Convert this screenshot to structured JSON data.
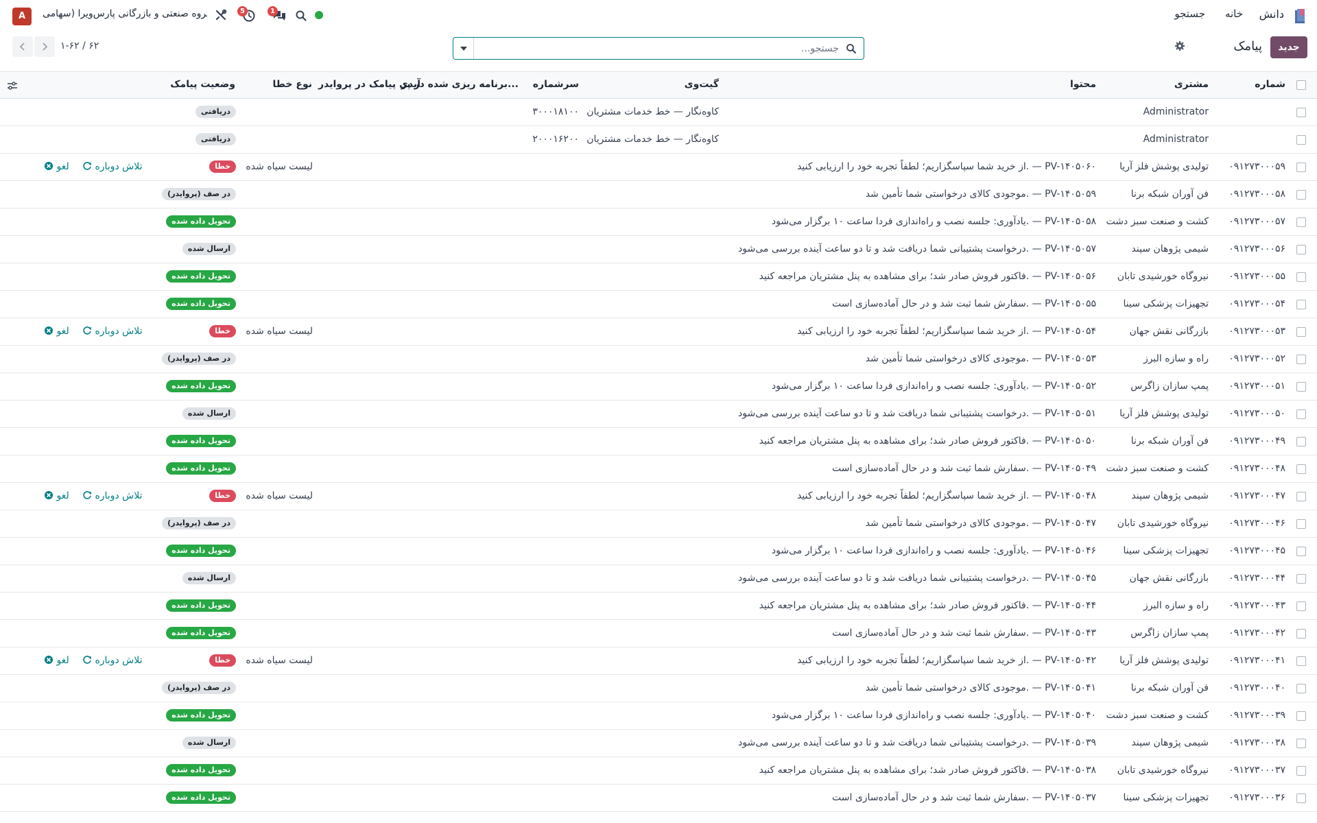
{
  "navbar": {
    "app_name": "دانش",
    "menu_home": "خانه",
    "menu_search": "جستجو",
    "company": "گروه صنعتی و بازرگانی پارس‌ویرا (سهامی ...",
    "activity_count": "5",
    "chat_count": "1",
    "avatar_letter": "A"
  },
  "control": {
    "new_button": "جدید",
    "title": "پیامک",
    "search_placeholder": "جستجو...",
    "pager": "۱-۶۲ / ۶۲"
  },
  "columns": {
    "number": "شماره",
    "customer": "مشتری",
    "content": "محتوا",
    "gateway": "گیت‌وی",
    "sender": "سرشماره",
    "scheduled": "برنامه ریزی شده در پر...",
    "provider_id": "آیدی پیامک در پروایدر",
    "error_type": "نوع خطا",
    "status": "وضعیت پیامک"
  },
  "actions": {
    "retry": "تلاش دوباره",
    "cancel": "لغو"
  },
  "rows": [
    {
      "number": "",
      "customer": "Administrator",
      "content": "",
      "gateway": "کاوه‌نگار — خط خدمات مشتریان",
      "sender": "۳۰۰۰۱۸۱۰۰",
      "error_type": "",
      "status": "دریافتی",
      "status_kind": "muted"
    },
    {
      "number": "",
      "customer": "Administrator",
      "content": "",
      "gateway": "کاوه‌نگار — خط خدمات مشتریان",
      "sender": "۲۰۰۰۱۶۲۰۰",
      "error_type": "",
      "status": "دریافتی",
      "status_kind": "muted"
    },
    {
      "number": "۰۹۱۲۷۳۰۰۰۵۹",
      "customer": "تولیدی پوشش فلز آریا",
      "content": "از خرید شما سپاسگزاریم؛ لطفاً تجربه خود را ارزیابی کنید. — PV-۱۴۰۵۰۶۰",
      "gateway": "",
      "sender": "",
      "error_type": "لیست سیاه شده",
      "status": "خطا",
      "status_kind": "danger"
    },
    {
      "number": "۰۹۱۲۷۳۰۰۰۵۸",
      "customer": "فن آوران شبکه برنا",
      "content": "موجودی کالای درخواستی شما تأمین شد. — PV-۱۴۰۵۰۵۹",
      "gateway": "",
      "sender": "",
      "error_type": "",
      "status": "در صف (پروایدر)",
      "status_kind": "muted"
    },
    {
      "number": "۰۹۱۲۷۳۰۰۰۵۷",
      "customer": "کشت و صنعت سبز دشت",
      "content": "یادآوری: جلسه نصب و راه‌اندازی فردا ساعت ۱۰ برگزار می‌شود. — PV-۱۴۰۵۰۵۸",
      "gateway": "",
      "sender": "",
      "error_type": "",
      "status": "تحویل داده شده",
      "status_kind": "success"
    },
    {
      "number": "۰۹۱۲۷۳۰۰۰۵۶",
      "customer": "شیمی پژوهان سپند",
      "content": "درخواست پشتیبانی شما دریافت شد و تا دو ساعت آینده بررسی می‌شود. — PV-۱۴۰۵۰۵۷",
      "gateway": "",
      "sender": "",
      "error_type": "",
      "status": "ارسال شده",
      "status_kind": "muted"
    },
    {
      "number": "۰۹۱۲۷۳۰۰۰۵۵",
      "customer": "نیروگاه خورشیدی تابان",
      "content": "فاکتور فروش صادر شد؛ برای مشاهده به پنل مشتریان مراجعه کنید. — PV-۱۴۰۵۰۵۶",
      "gateway": "",
      "sender": "",
      "error_type": "",
      "status": "تحویل داده شده",
      "status_kind": "success"
    },
    {
      "number": "۰۹۱۲۷۳۰۰۰۵۴",
      "customer": "تجهیزات پزشکی سینا",
      "content": "سفارش شما ثبت شد و در حال آماده‌سازی است. — PV-۱۴۰۵۰۵۵",
      "gateway": "",
      "sender": "",
      "error_type": "",
      "status": "تحویل داده شده",
      "status_kind": "success"
    },
    {
      "number": "۰۹۱۲۷۳۰۰۰۵۳",
      "customer": "بازرگانی نقش جهان",
      "content": "از خرید شما سپاسگزاریم؛ لطفاً تجربه خود را ارزیابی کنید. — PV-۱۴۰۵۰۵۴",
      "gateway": "",
      "sender": "",
      "error_type": "لیست سیاه شده",
      "status": "خطا",
      "status_kind": "danger"
    },
    {
      "number": "۰۹۱۲۷۳۰۰۰۵۲",
      "customer": "راه و سازه البرز",
      "content": "موجودی کالای درخواستی شما تأمین شد. — PV-۱۴۰۵۰۵۳",
      "gateway": "",
      "sender": "",
      "error_type": "",
      "status": "در صف (پروایدر)",
      "status_kind": "muted"
    },
    {
      "number": "۰۹۱۲۷۳۰۰۰۵۱",
      "customer": "پمپ سازان زاگرس",
      "content": "یادآوری: جلسه نصب و راه‌اندازی فردا ساعت ۱۰ برگزار می‌شود. — PV-۱۴۰۵۰۵۲",
      "gateway": "",
      "sender": "",
      "error_type": "",
      "status": "تحویل داده شده",
      "status_kind": "success"
    },
    {
      "number": "۰۹۱۲۷۳۰۰۰۵۰",
      "customer": "تولیدی پوشش فلز آریا",
      "content": "درخواست پشتیبانی شما دریافت شد و تا دو ساعت آینده بررسی می‌شود. — PV-۱۴۰۵۰۵۱",
      "gateway": "",
      "sender": "",
      "error_type": "",
      "status": "ارسال شده",
      "status_kind": "muted"
    },
    {
      "number": "۰۹۱۲۷۳۰۰۰۴۹",
      "customer": "فن آوران شبکه برنا",
      "content": "فاکتور فروش صادر شد؛ برای مشاهده به پنل مشتریان مراجعه کنید. — PV-۱۴۰۵۰۵۰",
      "gateway": "",
      "sender": "",
      "error_type": "",
      "status": "تحویل داده شده",
      "status_kind": "success"
    },
    {
      "number": "۰۹۱۲۷۳۰۰۰۴۸",
      "customer": "کشت و صنعت سبز دشت",
      "content": "سفارش شما ثبت شد و در حال آماده‌سازی است. — PV-۱۴۰۵۰۴۹",
      "gateway": "",
      "sender": "",
      "error_type": "",
      "status": "تحویل داده شده",
      "status_kind": "success"
    },
    {
      "number": "۰۹۱۲۷۳۰۰۰۴۷",
      "customer": "شیمی پژوهان سپند",
      "content": "از خرید شما سپاسگزاریم؛ لطفاً تجربه خود را ارزیابی کنید. — PV-۱۴۰۵۰۴۸",
      "gateway": "",
      "sender": "",
      "error_type": "لیست سیاه شده",
      "status": "خطا",
      "status_kind": "danger"
    },
    {
      "number": "۰۹۱۲۷۳۰۰۰۴۶",
      "customer": "نیروگاه خورشیدی تابان",
      "content": "موجودی کالای درخواستی شما تأمین شد. — PV-۱۴۰۵۰۴۷",
      "gateway": "",
      "sender": "",
      "error_type": "",
      "status": "در صف (پروایدر)",
      "status_kind": "muted"
    },
    {
      "number": "۰۹۱۲۷۳۰۰۰۴۵",
      "customer": "تجهیزات پزشکی سینا",
      "content": "یادآوری: جلسه نصب و راه‌اندازی فردا ساعت ۱۰ برگزار می‌شود. — PV-۱۴۰۵۰۴۶",
      "gateway": "",
      "sender": "",
      "error_type": "",
      "status": "تحویل داده شده",
      "status_kind": "success"
    },
    {
      "number": "۰۹۱۲۷۳۰۰۰۴۴",
      "customer": "بازرگانی نقش جهان",
      "content": "درخواست پشتیبانی شما دریافت شد و تا دو ساعت آینده بررسی می‌شود. — PV-۱۴۰۵۰۴۵",
      "gateway": "",
      "sender": "",
      "error_type": "",
      "status": "ارسال شده",
      "status_kind": "muted"
    },
    {
      "number": "۰۹۱۲۷۳۰۰۰۴۳",
      "customer": "راه و سازه البرز",
      "content": "فاکتور فروش صادر شد؛ برای مشاهده به پنل مشتریان مراجعه کنید. — PV-۱۴۰۵۰۴۴",
      "gateway": "",
      "sender": "",
      "error_type": "",
      "status": "تحویل داده شده",
      "status_kind": "success"
    },
    {
      "number": "۰۹۱۲۷۳۰۰۰۴۲",
      "customer": "پمپ سازان زاگرس",
      "content": "سفارش شما ثبت شد و در حال آماده‌سازی است. — PV-۱۴۰۵۰۴۳",
      "gateway": "",
      "sender": "",
      "error_type": "",
      "status": "تحویل داده شده",
      "status_kind": "success"
    },
    {
      "number": "۰۹۱۲۷۳۰۰۰۴۱",
      "customer": "تولیدی پوشش فلز آریا",
      "content": "از خرید شما سپاسگزاریم؛ لطفاً تجربه خود را ارزیابی کنید. — PV-۱۴۰۵۰۴۲",
      "gateway": "",
      "sender": "",
      "error_type": "لیست سیاه شده",
      "status": "خطا",
      "status_kind": "danger"
    },
    {
      "number": "۰۹۱۲۷۳۰۰۰۴۰",
      "customer": "فن آوران شبکه برنا",
      "content": "موجودی کالای درخواستی شما تأمین شد. — PV-۱۴۰۵۰۴۱",
      "gateway": "",
      "sender": "",
      "error_type": "",
      "status": "در صف (پروایدر)",
      "status_kind": "muted"
    },
    {
      "number": "۰۹۱۲۷۳۰۰۰۳۹",
      "customer": "کشت و صنعت سبز دشت",
      "content": "یادآوری: جلسه نصب و راه‌اندازی فردا ساعت ۱۰ برگزار می‌شود. — PV-۱۴۰۵۰۴۰",
      "gateway": "",
      "sender": "",
      "error_type": "",
      "status": "تحویل داده شده",
      "status_kind": "success"
    },
    {
      "number": "۰۹۱۲۷۳۰۰۰۳۸",
      "customer": "شیمی پژوهان سپند",
      "content": "درخواست پشتیبانی شما دریافت شد و تا دو ساعت آینده بررسی می‌شود. — PV-۱۴۰۵۰۳۹",
      "gateway": "",
      "sender": "",
      "error_type": "",
      "status": "ارسال شده",
      "status_kind": "muted"
    },
    {
      "number": "۰۹۱۲۷۳۰۰۰۳۷",
      "customer": "نیروگاه خورشیدی تابان",
      "content": "فاکتور فروش صادر شد؛ برای مشاهده به پنل مشتریان مراجعه کنید. — PV-۱۴۰۵۰۳۸",
      "gateway": "",
      "sender": "",
      "error_type": "",
      "status": "تحویل داده شده",
      "status_kind": "success"
    },
    {
      "number": "۰۹۱۲۷۳۰۰۰۳۶",
      "customer": "تجهیزات پزشکی سینا",
      "content": "سفارش شما ثبت شد و در حال آماده‌سازی است. — PV-۱۴۰۵۰۳۷",
      "gateway": "",
      "sender": "",
      "error_type": "",
      "status": "تحویل داده شده",
      "status_kind": "success"
    }
  ],
  "colors": {
    "brand": "#714b67",
    "link": "#017e84",
    "success": "#28a745",
    "danger": "#dc4b5d"
  }
}
